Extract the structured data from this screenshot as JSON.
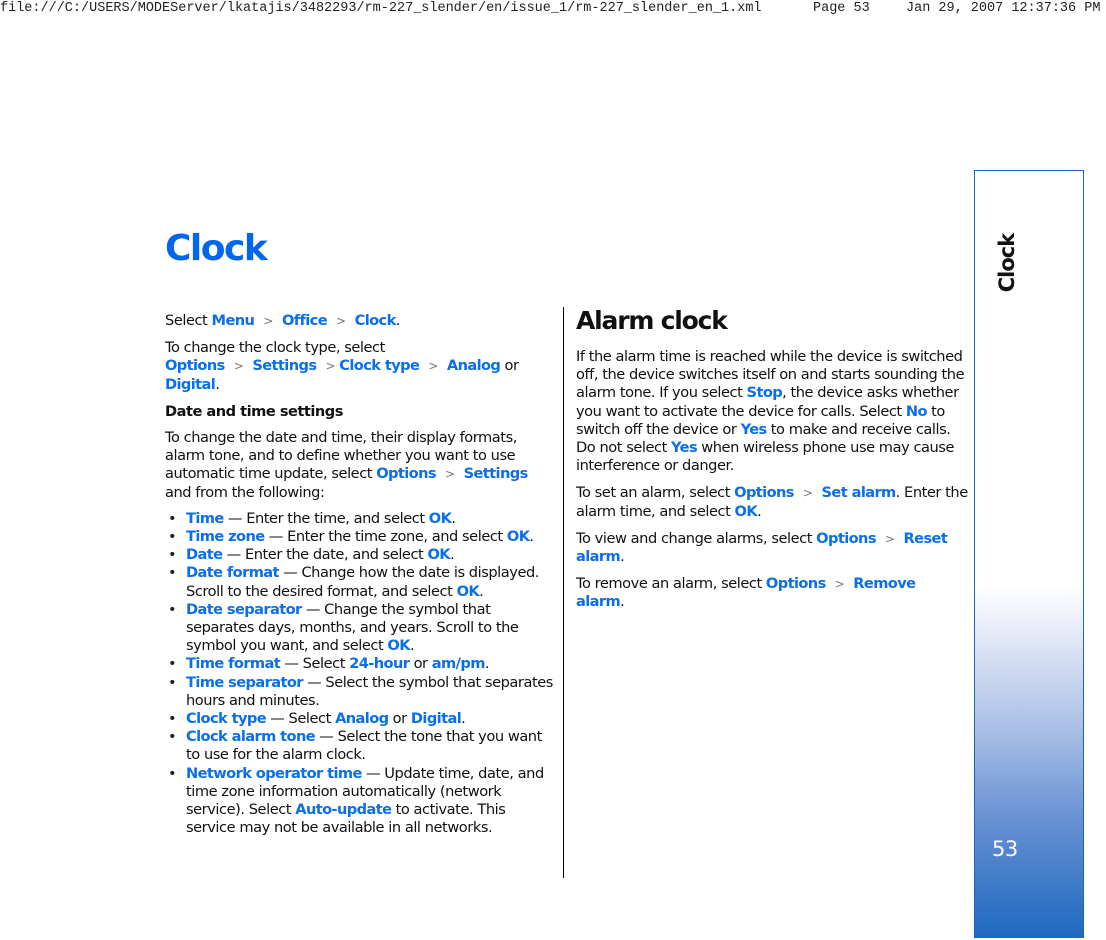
{
  "print_header": {
    "file_path": "file:///C:/USERS/MODEServer/lkatajis/3482293/rm-227_slender/en/issue_1/rm-227_slender_en_1.xml",
    "page": "Page 53",
    "timestamp": "Jan 29, 2007 12:37:36 PM"
  },
  "title": "Clock",
  "separator": ">",
  "left": {
    "intro": {
      "t1": "Select ",
      "l1": "Menu",
      "l2": "Office",
      "l3": "Clock",
      "t2": "."
    },
    "clock_type": {
      "t1": "To change the clock type, select ",
      "l1": "Options",
      "l2": "Settings",
      "l3": "Clock type",
      "l4": "Analog",
      "t2": " or ",
      "l5": "Digital",
      "t3": "."
    },
    "subheading": "Date and time settings",
    "dt_intro": {
      "t1": "To change the date and time, their display formats, alarm tone, and to define whether you want to use automatic time update, select ",
      "l1": "Options",
      "l2": "Settings",
      "t2": " and from the following:"
    },
    "items": [
      {
        "term": "Time",
        "t1": " — Enter the time, and select ",
        "l1": "OK",
        "t2": "."
      },
      {
        "term": "Time zone",
        "t1": " — Enter the time zone, and select ",
        "l1": "OK",
        "t2": "."
      },
      {
        "term": "Date",
        "t1": " — Enter the date, and select ",
        "l1": "OK",
        "t2": "."
      },
      {
        "term": "Date format",
        "t1": " — Change how the date is displayed. Scroll to the desired format, and select ",
        "l1": "OK",
        "t2": "."
      },
      {
        "term": "Date separator",
        "t1": " — Change the symbol that separates days, months, and years. Scroll to the symbol you want, and select ",
        "l1": "OK",
        "t2": "."
      },
      {
        "term": "Time format",
        "t1": " — Select ",
        "l1": "24-hour",
        "t2": " or ",
        "l2": "am/pm",
        "t3": "."
      },
      {
        "term": "Time separator",
        "t1": " — Select the symbol that separates hours and minutes."
      },
      {
        "term": "Clock type",
        "t1": " — Select ",
        "l1": "Analog",
        "t2": " or ",
        "l2": "Digital",
        "t3": "."
      },
      {
        "term": "Clock alarm tone",
        "t1": " — Select the tone that you want to use for the alarm clock."
      },
      {
        "term": "Network operator time",
        "t1": " — Update time, date, and time zone information automatically (network service). Select ",
        "l1": "Auto-update",
        "t2": " to activate. This service may not be available in all networks."
      }
    ]
  },
  "right": {
    "heading": "Alarm clock",
    "p1": {
      "t1": "If the alarm time is reached while the device is switched off, the device switches itself on and starts sounding the alarm tone. If you select ",
      "l1": "Stop",
      "t2": ", the device asks whether you want to activate the device for calls. Select ",
      "l2": "No",
      "t3": " to switch off the device or ",
      "l3": "Yes",
      "t4": " to make and receive calls. Do not select ",
      "l4": "Yes",
      "t5": " when wireless phone use may cause interference or danger."
    },
    "p2": {
      "t1": "To set an alarm, select ",
      "l1": "Options",
      "l2": "Set alarm",
      "t2": ". Enter the alarm time, and select ",
      "l3": "OK",
      "t3": "."
    },
    "p3": {
      "t1": "To view and change alarms, select ",
      "l1": "Options",
      "l2": "Reset alarm",
      "t2": "."
    },
    "p4": {
      "t1": "To remove an alarm, select ",
      "l1": "Options",
      "l2": "Remove alarm",
      "t2": "."
    }
  },
  "sidebar": {
    "chapter": "Clock",
    "page_number": "53"
  },
  "colors": {
    "link": "#0a6fe8",
    "title": "#0066ee",
    "sidebar_blue": "#1e69c0"
  }
}
